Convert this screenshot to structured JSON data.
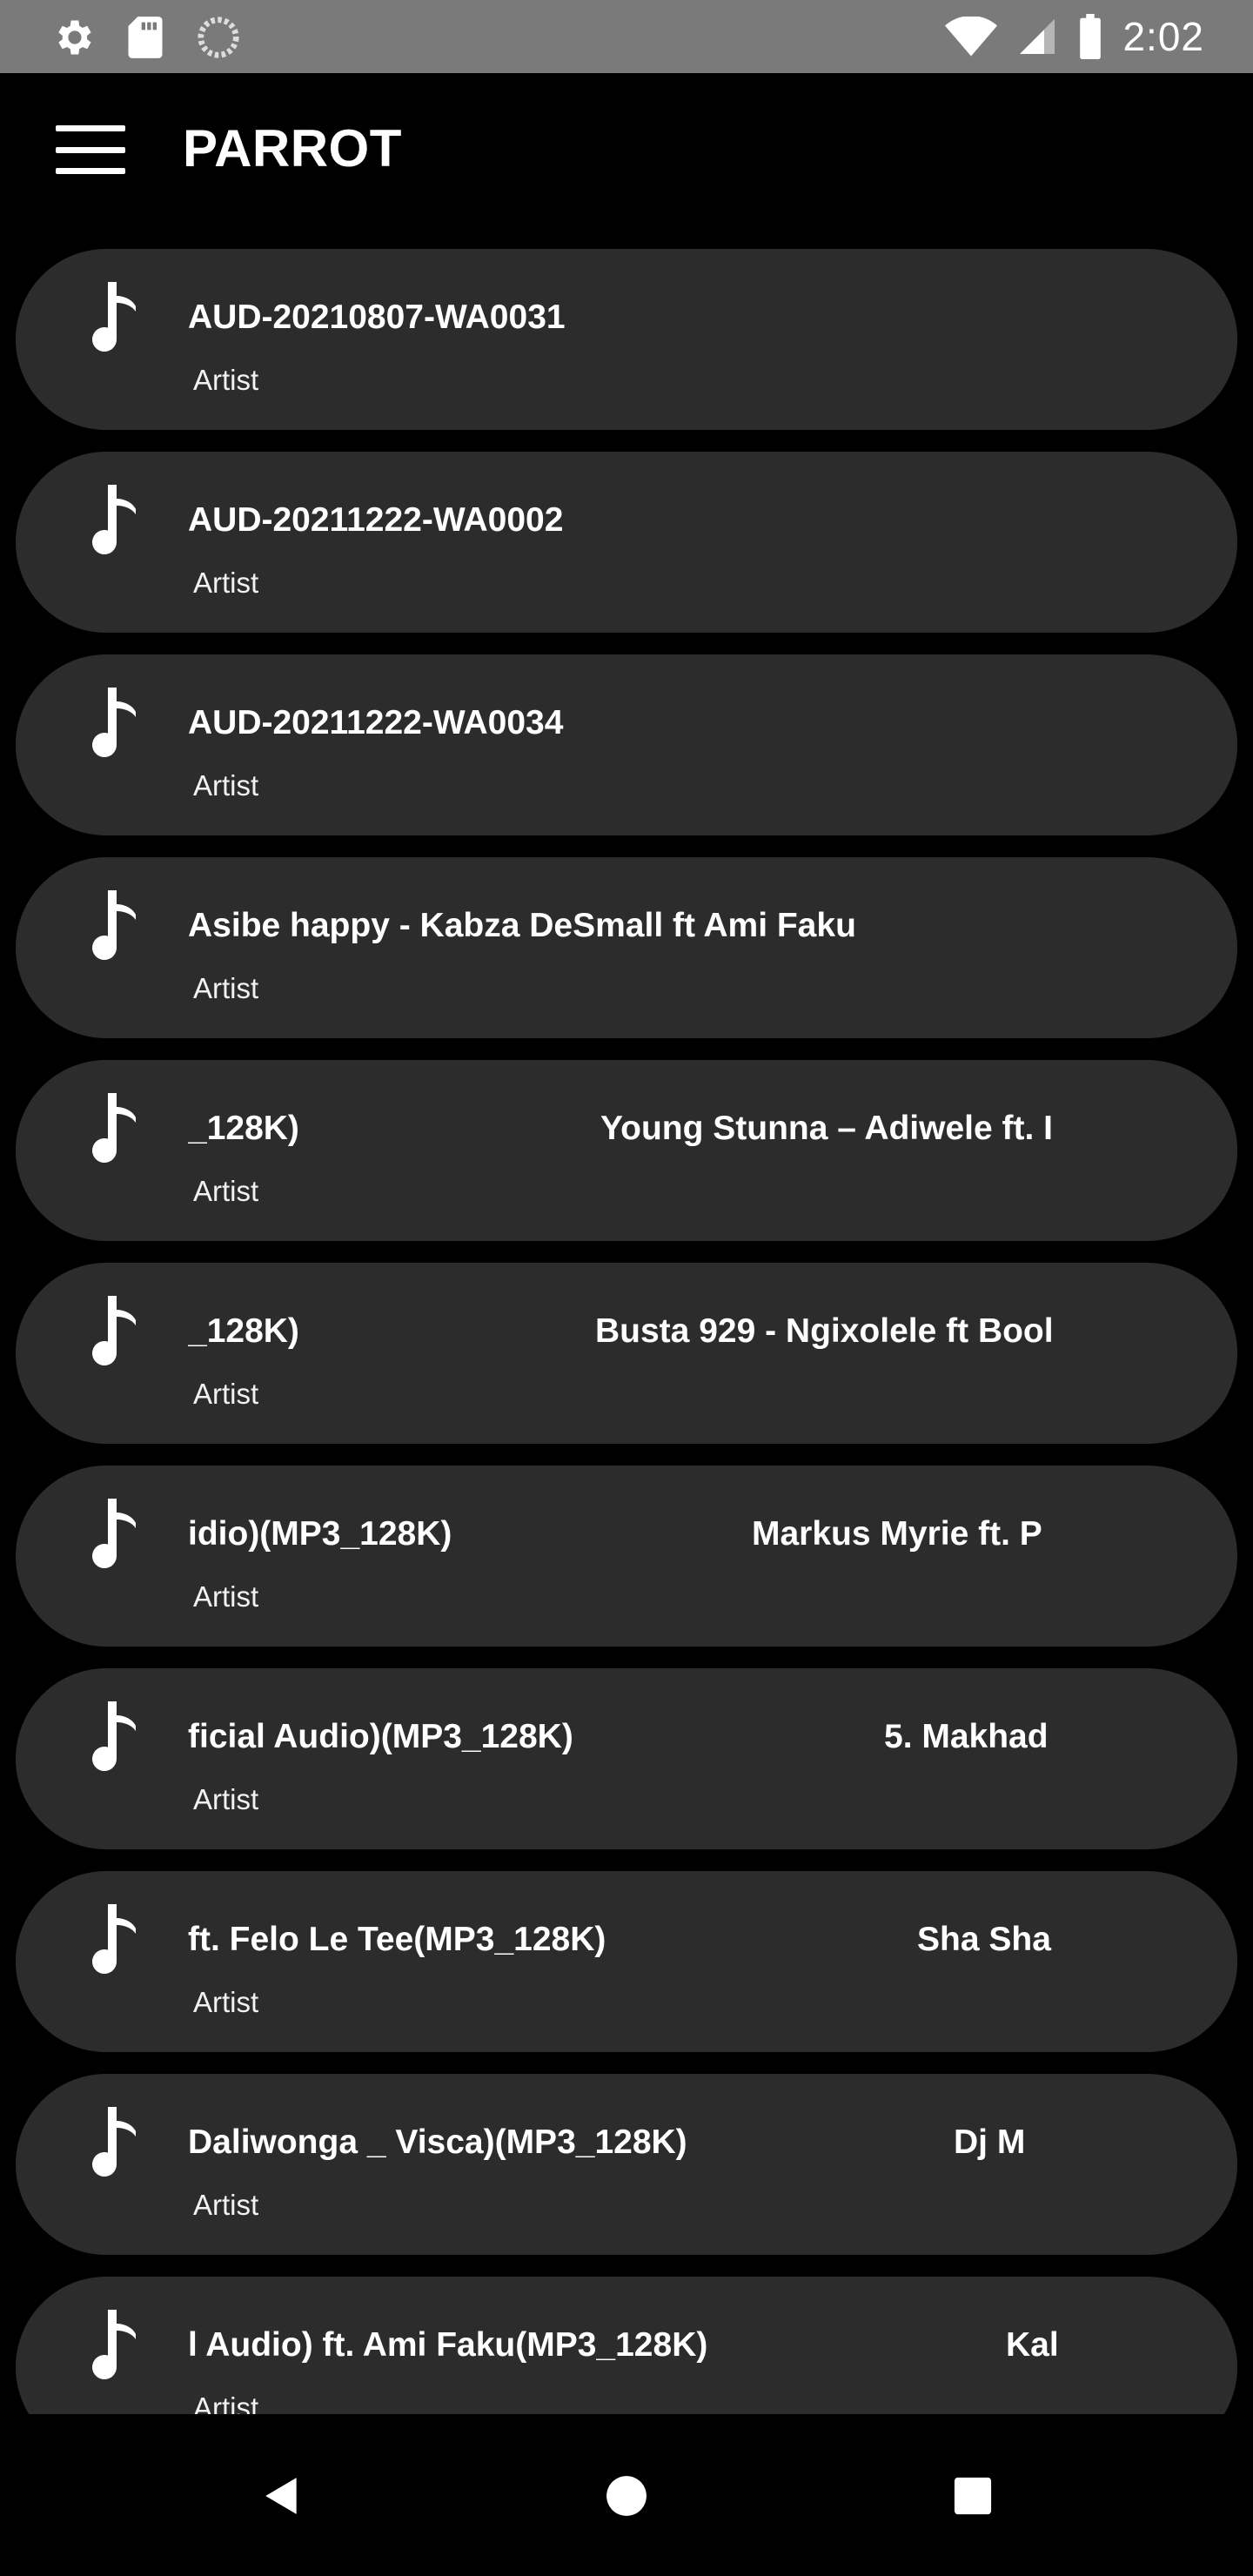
{
  "status_bar": {
    "time": "2:02",
    "icons_left": [
      "settings-icon",
      "sd-card-icon",
      "loading-icon"
    ],
    "icons_right": [
      "wifi-icon",
      "signal-icon",
      "battery-icon"
    ]
  },
  "app_bar": {
    "title": "PARROT",
    "menu_icon": "hamburger-menu-icon"
  },
  "songs": [
    {
      "title": "AUD-20210807-WA0031",
      "artist": "Artist"
    },
    {
      "title": "AUD-20211222-WA0002",
      "artist": "Artist"
    },
    {
      "title": "AUD-20211222-WA0034",
      "artist": "Artist"
    },
    {
      "title": "Asibe happy - Kabza DeSmall ft Ami Faku",
      "artist": "Artist"
    },
    {
      "title": "_128K)",
      "title_next": "Young Stunna – Adiwele ft. I",
      "artist": "Artist"
    },
    {
      "title": "_128K)",
      "title_next": "Busta 929 - Ngixolele ft Bool",
      "artist": "Artist"
    },
    {
      "title": "idio)(MP3_128K)",
      "title_next": "Markus Myrie ft. P",
      "artist": "Artist"
    },
    {
      "title": "ficial Audio)(MP3_128K)",
      "title_next": "5. Makhad",
      "artist": "Artist"
    },
    {
      "title": "ft. Felo Le Tee(MP3_128K)",
      "title_next": "Sha Sha",
      "artist": "Artist"
    },
    {
      "title": "Daliwonga _ Visca)(MP3_128K)",
      "title_next": "Dj M",
      "artist": "Artist"
    },
    {
      "title": "l Audio) ft. Ami Faku(MP3_128K)",
      "title_next": "Kal",
      "artist": "Artist"
    }
  ],
  "nav_bar": {
    "back_icon": "back-triangle-icon",
    "home_icon": "home-circle-icon",
    "recents_icon": "recents-square-icon"
  },
  "colors": {
    "status_bar_bg": "#7a7a7a",
    "background": "#000000",
    "card_bg": "#2c2c2c",
    "text": "#ffffff"
  }
}
